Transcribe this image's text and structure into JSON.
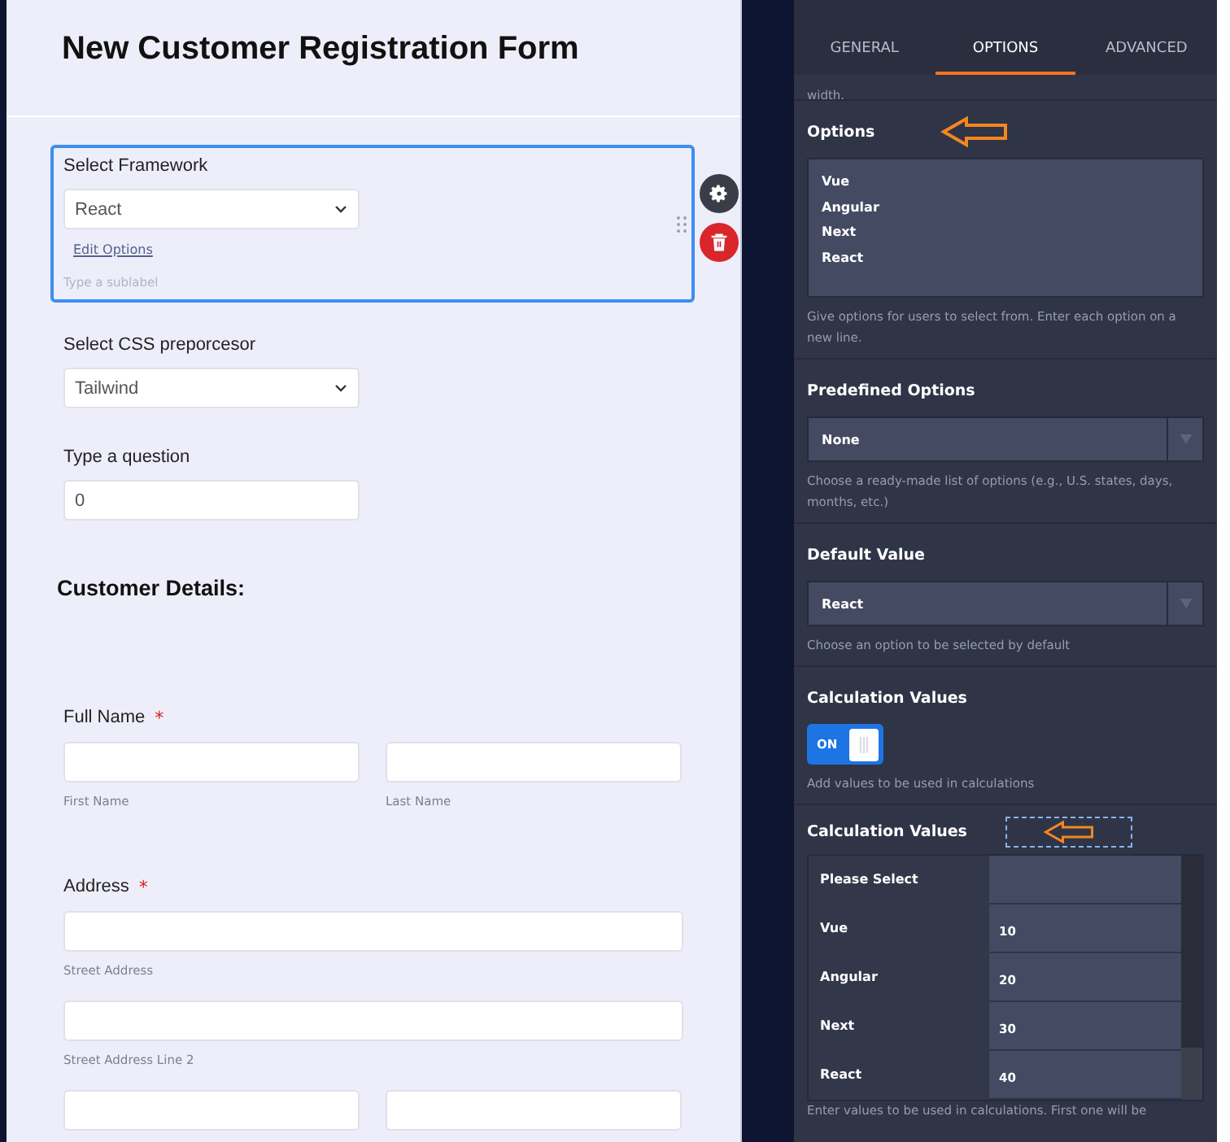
{
  "form": {
    "title": "New Customer Registration Form",
    "fields": [
      {
        "kind": "dropdown",
        "label": "Select Framework",
        "value": "React",
        "selected": true,
        "edit_link": "Edit Options",
        "sublabel_placeholder": "Type a sublabel"
      },
      {
        "kind": "dropdown",
        "label": "Select CSS preporcesor",
        "value": "Tailwind",
        "selected": false
      },
      {
        "kind": "textbox",
        "label": "Type a question",
        "value": "0"
      },
      {
        "kind": "heading",
        "text": "Customer Details:"
      },
      {
        "kind": "name",
        "label": "Full Name",
        "required_mark": "*",
        "sublabels": [
          "First Name",
          "Last Name"
        ]
      },
      {
        "kind": "address",
        "label": "Address",
        "required_mark": "*",
        "rows": [
          {
            "kind": "full",
            "sublabel": "Street Address"
          },
          {
            "kind": "full",
            "sublabel": "Street Address Line 2"
          },
          {
            "kind": "split"
          }
        ]
      }
    ]
  },
  "properties": {
    "tabs": [
      {
        "label": "GENERAL",
        "selected": false
      },
      {
        "label": "OPTIONS",
        "selected": true
      },
      {
        "label": "ADVANCED",
        "selected": false
      }
    ],
    "top_note": "width.",
    "sections": [
      {
        "kind": "textarea",
        "title": "Options",
        "arrow_annotation": true,
        "selection_box": false,
        "lines": [
          "Vue",
          "Angular",
          "Next",
          "React"
        ],
        "help": "Give options for users to select from. Enter each option on a new line."
      },
      {
        "kind": "select",
        "title": "Predefined Options",
        "value": "None",
        "help": "Choose a ready-made list of options (e.g., U.S. states, days, months, etc.)"
      },
      {
        "kind": "select",
        "title": "Default Value",
        "value": "React",
        "help": "Choose an option to be selected by default"
      },
      {
        "kind": "toggle",
        "title": "Calculation Values",
        "on": true,
        "state_label": "ON",
        "help": "Add values to be used in calculations"
      },
      {
        "kind": "calc_table",
        "title": "Calculation Values",
        "arrow_annotation": true,
        "selection_box": true,
        "rows": [
          {
            "option": "Please Select"
          },
          {
            "option": "Vue",
            "value": "10"
          },
          {
            "option": "Angular",
            "value": "20"
          },
          {
            "option": "Next",
            "value": "30"
          },
          {
            "option": "React",
            "value": "40"
          }
        ],
        "help": "Enter values to be used in calculations. First one will be"
      }
    ]
  }
}
